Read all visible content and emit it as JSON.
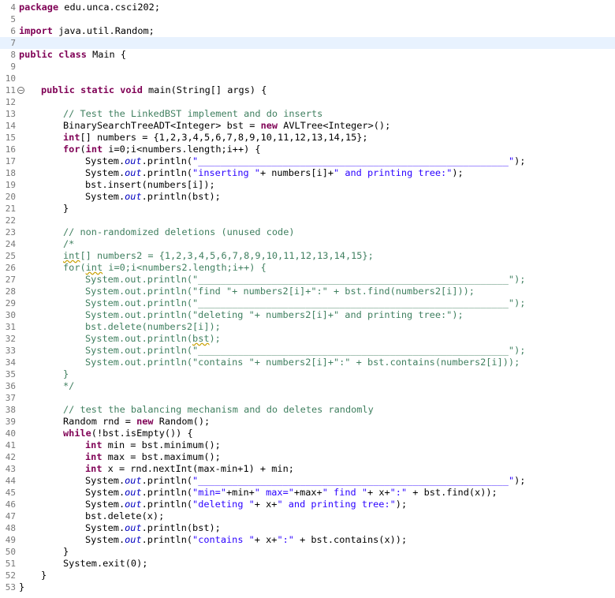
{
  "editor": {
    "line_numbers": [
      "4",
      "5",
      "6",
      "7",
      "8",
      "9",
      "10",
      "11",
      "12",
      "13",
      "14",
      "15",
      "16",
      "17",
      "18",
      "19",
      "20",
      "21",
      "22",
      "23",
      "24",
      "25",
      "26",
      "27",
      "28",
      "29",
      "30",
      "31",
      "32",
      "33",
      "34",
      "35",
      "36",
      "37",
      "38",
      "39",
      "40",
      "41",
      "42",
      "43",
      "44",
      "45",
      "46",
      "47",
      "48",
      "49",
      "50",
      "51",
      "52",
      "53"
    ],
    "current_line": "7",
    "fold_marker": "11",
    "code": {
      "l4": [
        "package",
        " edu.unca.csci202;"
      ],
      "l6": [
        "import",
        " java.util.Random;"
      ],
      "l8": [
        "public class",
        " Main {"
      ],
      "l11": [
        "public static void",
        " main(String[] args) {"
      ],
      "l13": "// Test the LinkedBST implement and do inserts",
      "l14": [
        "BinarySearchTreeADT<Integer> bst = ",
        "new",
        " AVLTree<Integer>();"
      ],
      "l15": [
        "int",
        "[] numbers = {1,2,3,4,5,6,7,8,9,10,11,12,13,14,15};"
      ],
      "l16": [
        "for",
        "(",
        "int",
        " i=0;i<numbers.length;i++) {"
      ],
      "l17": [
        "System.",
        "out",
        ".println(",
        "\"_______________________________________________________\"",
        ");"
      ],
      "l18": [
        "System.",
        "out",
        ".println(",
        "\"inserting \"",
        "+ numbers[i]+",
        "\" and printing tree:\"",
        ");"
      ],
      "l19": "bst.insert(numbers[i]);",
      "l20": [
        "System.",
        "out",
        ".println(bst);"
      ],
      "l21": "}",
      "l23": "// non-randomized deletions (unused code)",
      "l24": "/*",
      "l25": [
        "int",
        "[] numbers2 = {1,2,3,4,5,6,7,8,9,10,11,12,13,14,15};"
      ],
      "l26": [
        "for(",
        "int",
        " i=0;i<numbers2.length;i++) {"
      ],
      "l27": "System.out.println(\"_______________________________________________________\");",
      "l28": "System.out.println(\"find \"+ numbers2[i]+\":\" + bst.find(numbers2[i]));",
      "l29": "System.out.println(\"_______________________________________________________\");",
      "l30": "System.out.println(\"deleting \"+ numbers2[i]+\" and printing tree:\");",
      "l31": "bst.delete(numbers2[i]);",
      "l32": [
        "System.out.println(",
        "bst",
        ");"
      ],
      "l33": "System.out.println(\"_______________________________________________________\");",
      "l34": "System.out.println(\"contains \"+ numbers2[i]+\":\" + bst.contains(numbers2[i]));",
      "l35": "}",
      "l36": "*/",
      "l38": "// test the balancing mechanism and do deletes randomly",
      "l39": [
        "Random rnd = ",
        "new",
        " Random();"
      ],
      "l40": [
        "while",
        "(!bst.isEmpty()) {"
      ],
      "l41": [
        "int",
        " min = bst.minimum();"
      ],
      "l42": [
        "int",
        " max = bst.maximum();"
      ],
      "l43": [
        "int",
        " x = rnd.nextInt(max-min+1) + min;"
      ],
      "l44": [
        "System.",
        "out",
        ".println(",
        "\"_______________________________________________________\"",
        ");"
      ],
      "l45": [
        "System.",
        "out",
        ".println(",
        "\"min=\"",
        "+min+",
        "\" max=\"",
        "+max+",
        "\" find \"",
        "+ x+",
        "\":\"",
        " + bst.find(x));"
      ],
      "l46": [
        "System.",
        "out",
        ".println(",
        "\"deleting \"",
        "+ x+",
        "\" and printing tree:\"",
        ");"
      ],
      "l47": "bst.delete(x);",
      "l48": [
        "System.",
        "out",
        ".println(bst);"
      ],
      "l49": [
        "System.",
        "out",
        ".println(",
        "\"contains \"",
        "+ x+",
        "\":\"",
        " + bst.contains(x));"
      ],
      "l50": "}",
      "l51": "System.exit(0);",
      "l52": "}",
      "l53": "}"
    }
  },
  "colors": {
    "keyword": "#7f0055",
    "comment": "#3f7f5f",
    "string": "#2a00ff",
    "static_field": "#0000c0",
    "current_line_bg": "#e8f2fe",
    "line_number": "#787878"
  }
}
